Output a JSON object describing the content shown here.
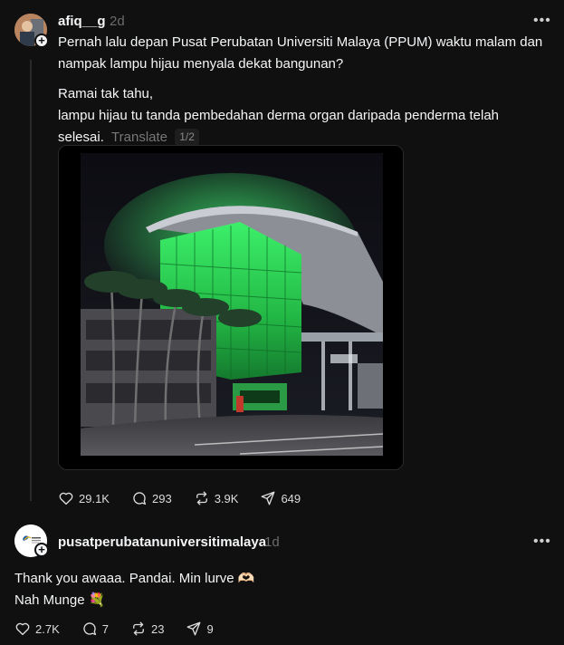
{
  "post": {
    "username": "afiq__g",
    "time": "2d",
    "paragraph1": "Pernah lalu depan Pusat Perubatan Universiti Malaya (PPUM) waktu malam dan",
    "paragraph1b": "nampak lampu hijau menyala dekat bangunan?",
    "paragraph2a": "Ramai tak tahu,",
    "paragraph2b": "lampu hijau tu tanda pembedahan derma organ daripada penderma telah",
    "paragraph2c": "selesai.",
    "translate": "Translate",
    "pager": "1/2",
    "likes": "29.1K",
    "comments": "293",
    "reposts": "3.9K",
    "shares": "649"
  },
  "reply": {
    "username": "pusatperubatanuniversitimalaya",
    "time": "1d",
    "line1": "Thank you awaaa. Pandai. Min lurve 🫶🏻",
    "line2": "Nah Munge 💐",
    "likes": "2.7K",
    "comments": "7",
    "reposts": "23",
    "shares": "9"
  },
  "icons": {
    "more": "more-icon",
    "like": "heart-icon",
    "comment": "comment-icon",
    "repost": "repost-icon",
    "share": "share-icon"
  },
  "colors": {
    "background": "#101010",
    "text": "#f3f5f7",
    "muted": "#6b6b6b",
    "building_glow": "#2bd14f"
  }
}
